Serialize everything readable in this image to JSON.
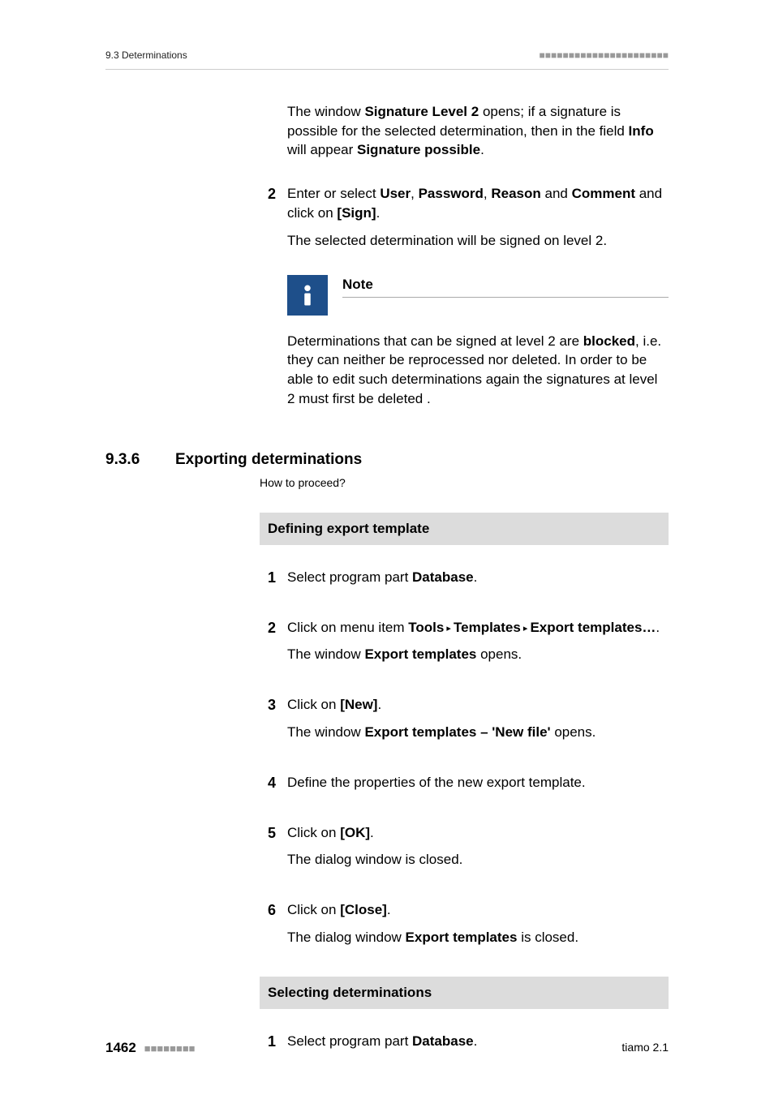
{
  "header": {
    "left": "9.3 Determinations",
    "deco": "■■■■■■■■■■■■■■■■■■■■■■"
  },
  "intro": {
    "p1a": "The window ",
    "p1b": "Signature Level 2",
    "p1c": " opens; if a signature is possible for the selected determination, then in the field ",
    "p1d": "Info",
    "p1e": " will appear ",
    "p1f": "Signature possible",
    "p1g": "."
  },
  "topstep": {
    "num": "2",
    "l1a": "Enter or select ",
    "l1b": "User",
    "l1c": ", ",
    "l1d": "Password",
    "l1e": ", ",
    "l1f": "Reason",
    "l1g": " and ",
    "l1h": "Comment",
    "l1i": " and click on ",
    "l1j": "[Sign]",
    "l1k": ".",
    "l2": "The selected determination will be signed on level 2."
  },
  "note": {
    "label": "Note",
    "t1": "Determinations that can be signed at level 2 are ",
    "t2": "blocked",
    "t3": ", i.e. they can neither be reprocessed nor deleted. In order to be able to edit such determinations again the signatures at level 2 must first be deleted ."
  },
  "section": {
    "num": "9.3.6",
    "title": "Exporting determinations",
    "howto": "How to proceed?"
  },
  "bar1": "Defining export template",
  "def": {
    "s1": {
      "n": "1",
      "a": "Select program part ",
      "b": "Database",
      "c": "."
    },
    "s2": {
      "n": "2",
      "a": "Click on menu item ",
      "b": "Tools",
      "c": " ▸ ",
      "d": "Templates",
      "e": " ▸ ",
      "f": "Export templates…",
      "g": ".",
      "r1a": "The window ",
      "r1b": "Export templates",
      "r1c": " opens."
    },
    "s3": {
      "n": "3",
      "a": "Click on ",
      "b": "[New]",
      "c": ".",
      "r1a": "The window ",
      "r1b": "Export templates – 'New file'",
      "r1c": " opens."
    },
    "s4": {
      "n": "4",
      "a": "Define the properties of the new export template."
    },
    "s5": {
      "n": "5",
      "a": "Click on ",
      "b": "[OK]",
      "c": ".",
      "r1": "The dialog window is closed."
    },
    "s6": {
      "n": "6",
      "a": "Click on ",
      "b": "[Close]",
      "c": ".",
      "r1a": "The dialog window ",
      "r1b": "Export templates",
      "r1c": " is closed."
    }
  },
  "bar2": "Selecting determinations",
  "sel": {
    "s1": {
      "n": "1",
      "a": "Select program part ",
      "b": "Database",
      "c": "."
    }
  },
  "footer": {
    "page": "1462",
    "deco": "■■■■■■■■",
    "right": "tiamo 2.1"
  }
}
